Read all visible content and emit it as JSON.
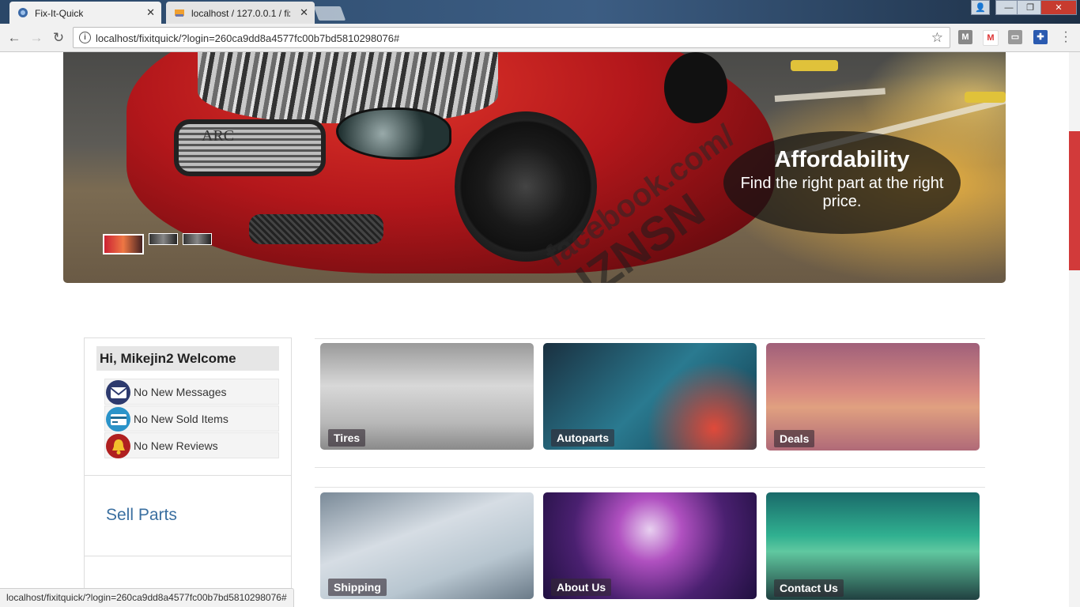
{
  "browser": {
    "tabs": [
      {
        "title": "Fix-It-Quick",
        "active": true
      },
      {
        "title": "localhost / 127.0.0.1 / fix",
        "active": false
      }
    ],
    "url": "localhost/fixitquick/?login=260ca9dd8a4577fc00b7bd5810298076#",
    "status_url": "localhost/fixitquick/?login=260ca9dd8a4577fc00b7bd5810298076#"
  },
  "hero": {
    "caption_title": "Affordability",
    "caption_text": "Find the right part at the right price.",
    "plate_text": "ARC",
    "watermark_1": "facebook.com/",
    "watermark_2": "IZNSN",
    "slides_count": 3,
    "active_slide": 1
  },
  "sidebar": {
    "welcome": "Hi, Mikejin2 Welcome",
    "notifications": [
      {
        "label": "No New Messages",
        "icon": "envelope-icon",
        "color": "#2d3a6e"
      },
      {
        "label": "No New Sold Items",
        "icon": "credit-card-icon",
        "color": "#2a93c9"
      },
      {
        "label": "No New Reviews",
        "icon": "bell-icon",
        "color": "#b02020"
      }
    ],
    "sell_link": "Sell Parts"
  },
  "tiles": [
    {
      "label": "Tires"
    },
    {
      "label": "Autoparts"
    },
    {
      "label": "Deals"
    },
    {
      "label": "Shipping"
    },
    {
      "label": "About Us"
    },
    {
      "label": "Contact Us"
    }
  ],
  "colors": {
    "link": "#3a6fa0",
    "scroll_thumb": "#d23a3a"
  }
}
